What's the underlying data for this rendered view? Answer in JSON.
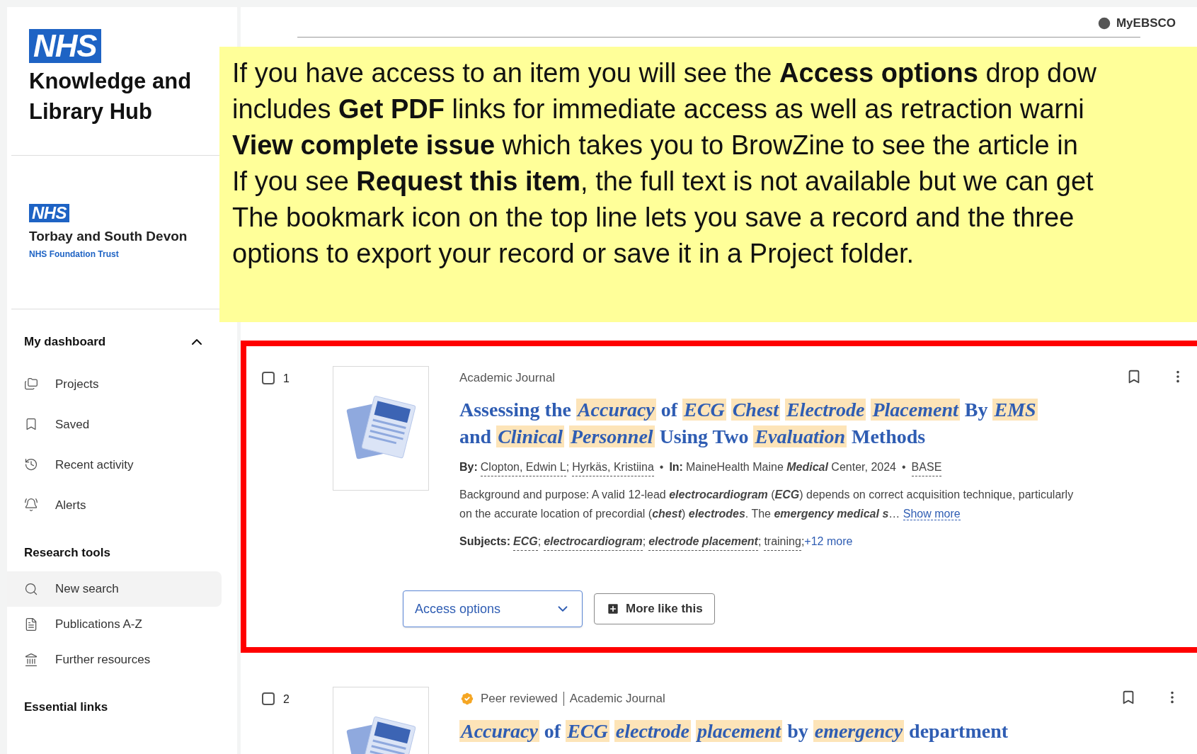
{
  "header": {
    "account": "MyEBSCO"
  },
  "sidebar": {
    "logo": {
      "badge": "NHS",
      "title": "Knowledge and Library Hub"
    },
    "trust": {
      "badge": "NHS",
      "name": "Torbay and South Devon",
      "subtitle": "NHS Foundation Trust"
    },
    "sections": [
      {
        "title": "My dashboard",
        "expanded": true,
        "items": [
          {
            "label": "Projects",
            "selected": false
          },
          {
            "label": "Saved",
            "selected": false
          },
          {
            "label": "Recent activity",
            "selected": false
          },
          {
            "label": "Alerts",
            "selected": false
          }
        ]
      },
      {
        "title": "Research tools",
        "items": [
          {
            "label": "New search",
            "selected": true
          },
          {
            "label": "Publications A-Z",
            "selected": false
          },
          {
            "label": "Further resources",
            "selected": false
          }
        ]
      },
      {
        "title": "Essential links"
      }
    ]
  },
  "callout": {
    "lines": [
      "If you have access to an item you will see the **Access options** drop dow",
      "includes **Get PDF** links for immediate access as well as retraction warni",
      "**View complete issue** which takes you to BrowZine to see the article in",
      "If you see **Request this item**, the full text is not available but we can get",
      "The bookmark icon on the top line lets you save a record and the three",
      "options to export your record or save it in a Project folder."
    ]
  },
  "results": [
    {
      "number": "1",
      "checked": false,
      "outlined": true,
      "type": "Academic Journal",
      "title": [
        {
          "text": "Assessing the",
          "hit": false
        },
        {
          "text": "Accuracy",
          "hit": true
        },
        {
          "text": "of",
          "hit": false
        },
        {
          "text": "ECG",
          "hit": true
        },
        {
          "text": "Chest",
          "hit": true
        },
        {
          "text": "Electrode",
          "hit": true
        },
        {
          "text": "Placement",
          "hit": true
        },
        {
          "text": "By",
          "hit": false
        },
        {
          "text": "EMS",
          "hit": true
        },
        {
          "text": "and",
          "hit": false
        },
        {
          "text": "Clinical",
          "hit": true
        },
        {
          "text": "Personnel",
          "hit": true
        },
        {
          "text": "Using Two",
          "hit": false
        },
        {
          "text": "Evaluation",
          "hit": true
        },
        {
          "text": "Methods",
          "hit": false
        }
      ],
      "byline": {
        "by_label": "By:",
        "authors": [
          "Clopton, Edwin L",
          "Hyrkäs, Kristiina"
        ],
        "author_delimiter": ";",
        "separator": "•",
        "in_label": "In:",
        "source": "MaineHealth Maine **Medical** Center, 2024",
        "database": "BASE"
      },
      "abstract": "Background and purpose: A valid 12-lead **electrocardiogram** (**ECG**) depends on correct acquisition technique, particularly on the accurate location of precordial (**chest**) **electrodes**. The **emergency medical s**…",
      "show_more": "Show more",
      "subjects": {
        "label": "Subjects:",
        "delimiter": ";",
        "items": [
          {
            "text": "ECG",
            "hit": true
          },
          {
            "text": "electrocardiogram",
            "hit": true
          },
          {
            "text": "electrode placement",
            "hit": true
          },
          {
            "text": "training",
            "hit": false
          }
        ],
        "more": "+12 more"
      },
      "access_button": "Access options",
      "more_like_button": "More like this"
    },
    {
      "number": "2",
      "checked": false,
      "peer_reviewed": "Peer reviewed",
      "type": "Academic Journal",
      "title": [
        {
          "text": "Accuracy",
          "hit": true
        },
        {
          "text": "of",
          "hit": false
        },
        {
          "text": "ECG",
          "hit": true
        },
        {
          "text": "electrode",
          "hit": true
        },
        {
          "text": "placement",
          "hit": true
        },
        {
          "text": "by",
          "hit": false
        },
        {
          "text": "emergency",
          "hit": true
        },
        {
          "text": "department",
          "hit": false
        }
      ]
    }
  ]
}
